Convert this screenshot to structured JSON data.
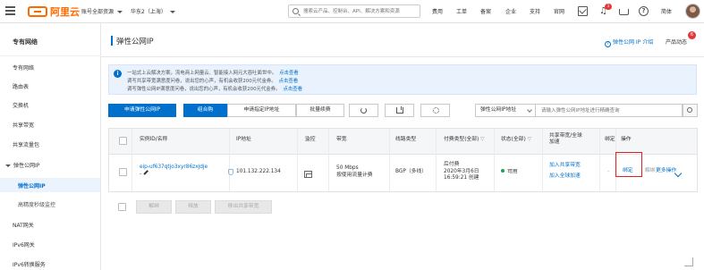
{
  "topbar": {
    "logo_text": "阿里云",
    "account_selector": "账号全部资源",
    "region_selector": "华东2（上海）",
    "search_placeholder": "搜索云产品、控制台、API、解决方案和资源",
    "nav": [
      "费用",
      "工单",
      "备案",
      "企业",
      "支持",
      "官网"
    ],
    "notification_count": "1",
    "language": "简体"
  },
  "sidebar": {
    "title": "专有网络",
    "items": [
      "专有网络",
      "路由表",
      "交换机",
      "共享带宽",
      "共享流量包"
    ],
    "group": "弹性公网IP",
    "sub_items": [
      "弹性公网IP",
      "高精度秒级监控"
    ],
    "after_items": [
      "NAT网关",
      "IPv6网关",
      "IPv6转换服务"
    ]
  },
  "header": {
    "title": "弹性公网IP",
    "help_link": "弹性公网 IP 介绍",
    "news_label": "产品动态",
    "news_badge": "6"
  },
  "notice": {
    "line1": "一站式上云解决方案，流电商上网量云、智能接入网元大吞吐面世中。",
    "line1_link": "点击查看",
    "line2": "调写共享带宽满意度问卷，说出您的心声，有机会收获200元代金券。",
    "line2_link": "点击查看",
    "line3": "调写弹性公网IP满意度问卷，说出您的心声，有机会收获200元代金券。",
    "line3_link": "点击查看"
  },
  "toolbar": {
    "apply_eip": "申请弹性公网IP",
    "combo": "组合购",
    "apply_specified": "申请指定IP地址",
    "bulk_renew": "批量续费",
    "filter_select": "弹性公网IP地址",
    "filter_placeholder": "请输入弹性公网IP地址进行精确查询"
  },
  "table": {
    "headers": {
      "instance": "实例ID/名称",
      "ip": "IP地址",
      "monitor": "监控",
      "bandwidth": "带宽",
      "line_type": "线路类型",
      "pay_type": "付费类型(全部)",
      "status": "状态(全部)",
      "share_1": "共享带宽/全球",
      "share_2": "加速",
      "bind": "绑定",
      "ops": "操作"
    },
    "row": {
      "instance_id_1": "eip-uf637qtjo3xyr86zxjdje",
      "instance_id_2": "-",
      "ip": "101.132.222.134",
      "bandwidth_1": "50 Mbps",
      "bandwidth_2": "按使用流量计费",
      "line_type": "BGP（多线）",
      "pay_type_1": "后付费",
      "pay_type_2": "2020年3月6日",
      "pay_type_3": "16:59:21 创建",
      "status": "可用",
      "share_link_1": "加入共享带宽",
      "share_link_2": "加入全球加速",
      "bind_value": "-",
      "op_bind": "绑定",
      "op_unbind": "解绑",
      "op_more": "更多操作"
    }
  },
  "bulk_actions": [
    "解绑",
    "释放",
    "移出共享带宽"
  ],
  "colors": {
    "primary": "#0070cc",
    "brand": "#ff6a00",
    "highlight": "#e02020",
    "available": "#1aa05a"
  }
}
